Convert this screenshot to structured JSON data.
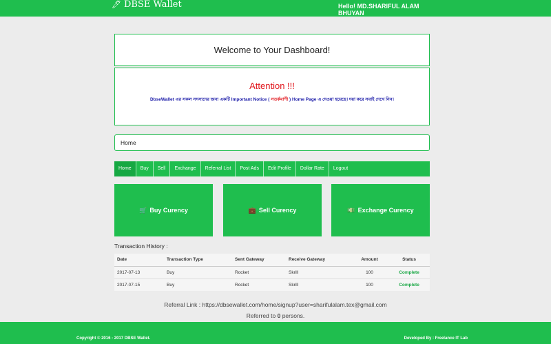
{
  "header": {
    "brand": "DBSE Wallet",
    "greeting": "Hello! MD.SHARIFUL ALAM BHUYAN"
  },
  "welcome": {
    "title": "Welcome to Your Dashboard!"
  },
  "attention": {
    "title": "Attention !!!",
    "notice_part1": "DbseWallet এর সকল সদস্যদের জন্য একটি Important Notice (",
    "notice_red": "সতর্কবাণী",
    "notice_part2": ") Home Page এ দেওয়া হয়েছে। দয়া করে সবাই দেখে নিন।"
  },
  "breadcrumb": {
    "label": "Home"
  },
  "nav": {
    "items": [
      "Home",
      "Buy",
      "Sell",
      "Exchange",
      "Referral List",
      "Post Ads",
      "Edit Profile",
      "Dollar Rate",
      "Logout"
    ]
  },
  "tiles": {
    "buy": "Buy Curency",
    "sell": "Sell Curency",
    "exchange": "Exchange Curency"
  },
  "transactions": {
    "title": "Transaction History :",
    "headers": [
      "Date",
      "Transaction Type",
      "Sent Gateway",
      "Receive Gateway",
      "Amount",
      "Status"
    ],
    "rows": [
      [
        "2017-07-13",
        "Buy",
        "Rocket",
        "Skrill",
        "100",
        "Complete"
      ],
      [
        "2017-07-15",
        "Buy",
        "Rocket",
        "Skrill",
        "100",
        "Complete"
      ]
    ]
  },
  "referral": {
    "link_text": "Referral Link : https://dbsewallet.com/home/signup?user=sharifulalam.tex@gmail.com",
    "referred_prefix": "Referred to ",
    "referred_count": "0",
    "referred_suffix": " persons."
  },
  "footer": {
    "copyright": "Copyright © 2016 - 2017 DBSE Wallet.",
    "developed": "Developed By : Freelance IT Lab"
  },
  "colors": {
    "brand_green": "#1fbe4e",
    "attention_red": "#e0141a",
    "notice_blue": "#1a1aa8"
  }
}
